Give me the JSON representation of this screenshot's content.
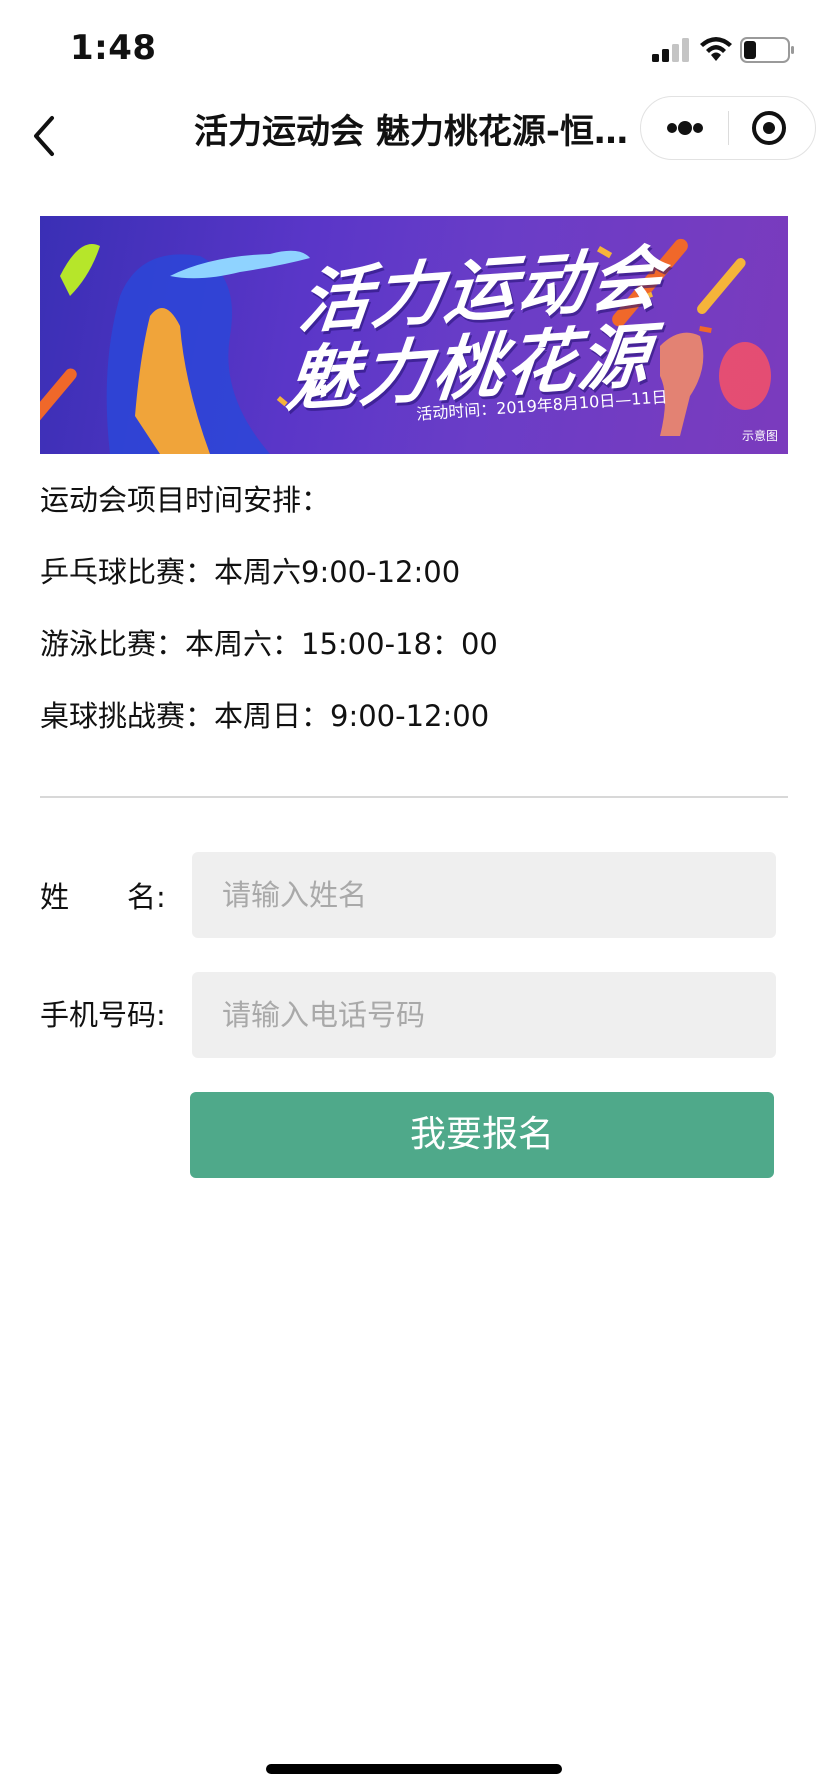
{
  "status_bar": {
    "time": "1:48",
    "icons": [
      "signal-icon",
      "wifi-icon",
      "battery-icon"
    ]
  },
  "nav": {
    "title": "活力运动会 魅力桃花源-恒…",
    "back_icon": "chevron-left-icon",
    "more_icon": "more-dots-icon",
    "close_icon": "target-circle-icon"
  },
  "banner": {
    "title_line1": "活力运动会",
    "title_line2": "魅力桃花源",
    "date": "活动时间：2019年8月10日—11日",
    "note": "示意图",
    "colors": {
      "bg_start": "#3a2fb5",
      "bg_end": "#7b3bbd",
      "accent_orange": "#f0682a",
      "accent_yellow": "#f5b43a"
    }
  },
  "schedule": {
    "heading": "运动会项目时间安排：",
    "items": [
      "乒乓球比赛：本周六9:00-12:00",
      "游泳比赛：本周六：15:00-18：00",
      "桌球挑战赛：本周日：9:00-12:00"
    ]
  },
  "form": {
    "name_label": "姓　　名:",
    "name_placeholder": "请输入姓名",
    "name_value": "",
    "phone_label": "手机号码:",
    "phone_placeholder": "请输入电话号码",
    "phone_value": "",
    "submit_label": "我要报名",
    "submit_color": "#4fa98a"
  }
}
